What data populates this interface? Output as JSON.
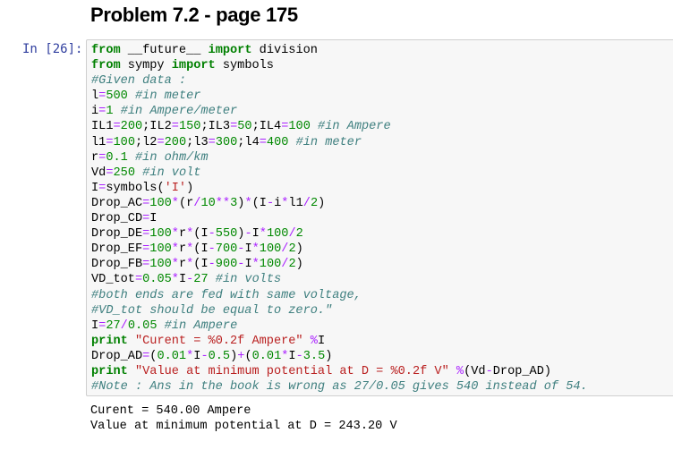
{
  "heading": "Problem 7.2 - page 175",
  "cell": {
    "prompt": "In [26]:",
    "code_lines": [
      [
        [
          "kw",
          "from"
        ],
        [
          "t",
          " __future__ "
        ],
        [
          "kw",
          "import"
        ],
        [
          "t",
          " division"
        ]
      ],
      [
        [
          "kw",
          "from"
        ],
        [
          "t",
          " sympy "
        ],
        [
          "kw",
          "import"
        ],
        [
          "t",
          " symbols"
        ]
      ],
      [
        [
          "cm",
          "#Given data :"
        ]
      ],
      [
        [
          "t",
          "l"
        ],
        [
          "op",
          "="
        ],
        [
          "nm",
          "500"
        ],
        [
          "t",
          " "
        ],
        [
          "cm",
          "#in meter"
        ]
      ],
      [
        [
          "t",
          "i"
        ],
        [
          "op",
          "="
        ],
        [
          "nm",
          "1"
        ],
        [
          "t",
          " "
        ],
        [
          "cm",
          "#in Ampere/meter"
        ]
      ],
      [
        [
          "t",
          "IL1"
        ],
        [
          "op",
          "="
        ],
        [
          "nm",
          "200"
        ],
        [
          "t",
          ";IL2"
        ],
        [
          "op",
          "="
        ],
        [
          "nm",
          "150"
        ],
        [
          "t",
          ";IL3"
        ],
        [
          "op",
          "="
        ],
        [
          "nm",
          "50"
        ],
        [
          "t",
          ";IL4"
        ],
        [
          "op",
          "="
        ],
        [
          "nm",
          "100"
        ],
        [
          "t",
          " "
        ],
        [
          "cm",
          "#in Ampere"
        ]
      ],
      [
        [
          "t",
          "l1"
        ],
        [
          "op",
          "="
        ],
        [
          "nm",
          "100"
        ],
        [
          "t",
          ";l2"
        ],
        [
          "op",
          "="
        ],
        [
          "nm",
          "200"
        ],
        [
          "t",
          ";l3"
        ],
        [
          "op",
          "="
        ],
        [
          "nm",
          "300"
        ],
        [
          "t",
          ";l4"
        ],
        [
          "op",
          "="
        ],
        [
          "nm",
          "400"
        ],
        [
          "t",
          " "
        ],
        [
          "cm",
          "#in meter"
        ]
      ],
      [
        [
          "t",
          "r"
        ],
        [
          "op",
          "="
        ],
        [
          "nm",
          "0.1"
        ],
        [
          "t",
          " "
        ],
        [
          "cm",
          "#in ohm/km"
        ]
      ],
      [
        [
          "t",
          "Vd"
        ],
        [
          "op",
          "="
        ],
        [
          "nm",
          "250"
        ],
        [
          "t",
          " "
        ],
        [
          "cm",
          "#in volt"
        ]
      ],
      [
        [
          "t",
          "I"
        ],
        [
          "op",
          "="
        ],
        [
          "t",
          "symbols("
        ],
        [
          "st",
          "'I'"
        ],
        [
          "t",
          ")"
        ]
      ],
      [
        [
          "t",
          "Drop_AC"
        ],
        [
          "op",
          "="
        ],
        [
          "nm",
          "100"
        ],
        [
          "op",
          "*"
        ],
        [
          "t",
          "(r"
        ],
        [
          "op",
          "/"
        ],
        [
          "nm",
          "10"
        ],
        [
          "op",
          "**"
        ],
        [
          "nm",
          "3"
        ],
        [
          "t",
          ")"
        ],
        [
          "op",
          "*"
        ],
        [
          "t",
          "(I"
        ],
        [
          "op",
          "-"
        ],
        [
          "t",
          "i"
        ],
        [
          "op",
          "*"
        ],
        [
          "t",
          "l1"
        ],
        [
          "op",
          "/"
        ],
        [
          "nm",
          "2"
        ],
        [
          "t",
          ")"
        ]
      ],
      [
        [
          "t",
          "Drop_CD"
        ],
        [
          "op",
          "="
        ],
        [
          "t",
          "I"
        ]
      ],
      [
        [
          "t",
          "Drop_DE"
        ],
        [
          "op",
          "="
        ],
        [
          "nm",
          "100"
        ],
        [
          "op",
          "*"
        ],
        [
          "t",
          "r"
        ],
        [
          "op",
          "*"
        ],
        [
          "t",
          "(I"
        ],
        [
          "op",
          "-"
        ],
        [
          "nm",
          "550"
        ],
        [
          "t",
          ")"
        ],
        [
          "op",
          "-"
        ],
        [
          "t",
          "I"
        ],
        [
          "op",
          "*"
        ],
        [
          "nm",
          "100"
        ],
        [
          "op",
          "/"
        ],
        [
          "nm",
          "2"
        ]
      ],
      [
        [
          "t",
          "Drop_EF"
        ],
        [
          "op",
          "="
        ],
        [
          "nm",
          "100"
        ],
        [
          "op",
          "*"
        ],
        [
          "t",
          "r"
        ],
        [
          "op",
          "*"
        ],
        [
          "t",
          "(I"
        ],
        [
          "op",
          "-"
        ],
        [
          "nm",
          "700"
        ],
        [
          "op",
          "-"
        ],
        [
          "t",
          "I"
        ],
        [
          "op",
          "*"
        ],
        [
          "nm",
          "100"
        ],
        [
          "op",
          "/"
        ],
        [
          "nm",
          "2"
        ],
        [
          "t",
          ")"
        ]
      ],
      [
        [
          "t",
          "Drop_FB"
        ],
        [
          "op",
          "="
        ],
        [
          "nm",
          "100"
        ],
        [
          "op",
          "*"
        ],
        [
          "t",
          "r"
        ],
        [
          "op",
          "*"
        ],
        [
          "t",
          "(I"
        ],
        [
          "op",
          "-"
        ],
        [
          "nm",
          "900"
        ],
        [
          "op",
          "-"
        ],
        [
          "t",
          "I"
        ],
        [
          "op",
          "*"
        ],
        [
          "nm",
          "100"
        ],
        [
          "op",
          "/"
        ],
        [
          "nm",
          "2"
        ],
        [
          "t",
          ")"
        ]
      ],
      [
        [
          "t",
          "VD_tot"
        ],
        [
          "op",
          "="
        ],
        [
          "nm",
          "0.05"
        ],
        [
          "op",
          "*"
        ],
        [
          "t",
          "I"
        ],
        [
          "op",
          "-"
        ],
        [
          "nm",
          "27"
        ],
        [
          "t",
          " "
        ],
        [
          "cm",
          "#in volts"
        ]
      ],
      [
        [
          "cm",
          "#both ends are fed with same voltage,"
        ]
      ],
      [
        [
          "cm",
          "#VD_tot should be equal to zero.\""
        ]
      ],
      [
        [
          "t",
          "I"
        ],
        [
          "op",
          "="
        ],
        [
          "nm",
          "27"
        ],
        [
          "op",
          "/"
        ],
        [
          "nm",
          "0.05"
        ],
        [
          "t",
          " "
        ],
        [
          "cm",
          "#in Ampere"
        ]
      ],
      [
        [
          "kw",
          "print"
        ],
        [
          "t",
          " "
        ],
        [
          "st",
          "\"Curent = %0.2f Ampere\""
        ],
        [
          "t",
          " "
        ],
        [
          "op",
          "%"
        ],
        [
          "t",
          "I"
        ]
      ],
      [
        [
          "t",
          "Drop_AD"
        ],
        [
          "op",
          "="
        ],
        [
          "t",
          "("
        ],
        [
          "nm",
          "0.01"
        ],
        [
          "op",
          "*"
        ],
        [
          "t",
          "I"
        ],
        [
          "op",
          "-"
        ],
        [
          "nm",
          "0.5"
        ],
        [
          "t",
          ")"
        ],
        [
          "op",
          "+"
        ],
        [
          "t",
          "("
        ],
        [
          "nm",
          "0.01"
        ],
        [
          "op",
          "*"
        ],
        [
          "t",
          "I"
        ],
        [
          "op",
          "-"
        ],
        [
          "nm",
          "3.5"
        ],
        [
          "t",
          ")"
        ]
      ],
      [
        [
          "kw",
          "print"
        ],
        [
          "t",
          " "
        ],
        [
          "st",
          "\"Value at minimum potential at D = %0.2f V\""
        ],
        [
          "t",
          " "
        ],
        [
          "op",
          "%"
        ],
        [
          "t",
          "(Vd"
        ],
        [
          "op",
          "-"
        ],
        [
          "t",
          "Drop_AD)"
        ]
      ],
      [
        [
          "cm",
          "#Note : Ans in the book is wrong as 27/0.05 gives 540 instead of 54."
        ]
      ]
    ]
  },
  "output": {
    "lines": [
      "Curent = 540.00 Ampere",
      "Value at minimum potential at D = 243.20 V"
    ]
  },
  "colors": {
    "keyword": "#008000",
    "comment": "#408080",
    "number": "#008800",
    "operator": "#aa22ff",
    "string": "#ba2121",
    "prompt": "#303f9f",
    "cell_background": "#f7f7f7"
  }
}
